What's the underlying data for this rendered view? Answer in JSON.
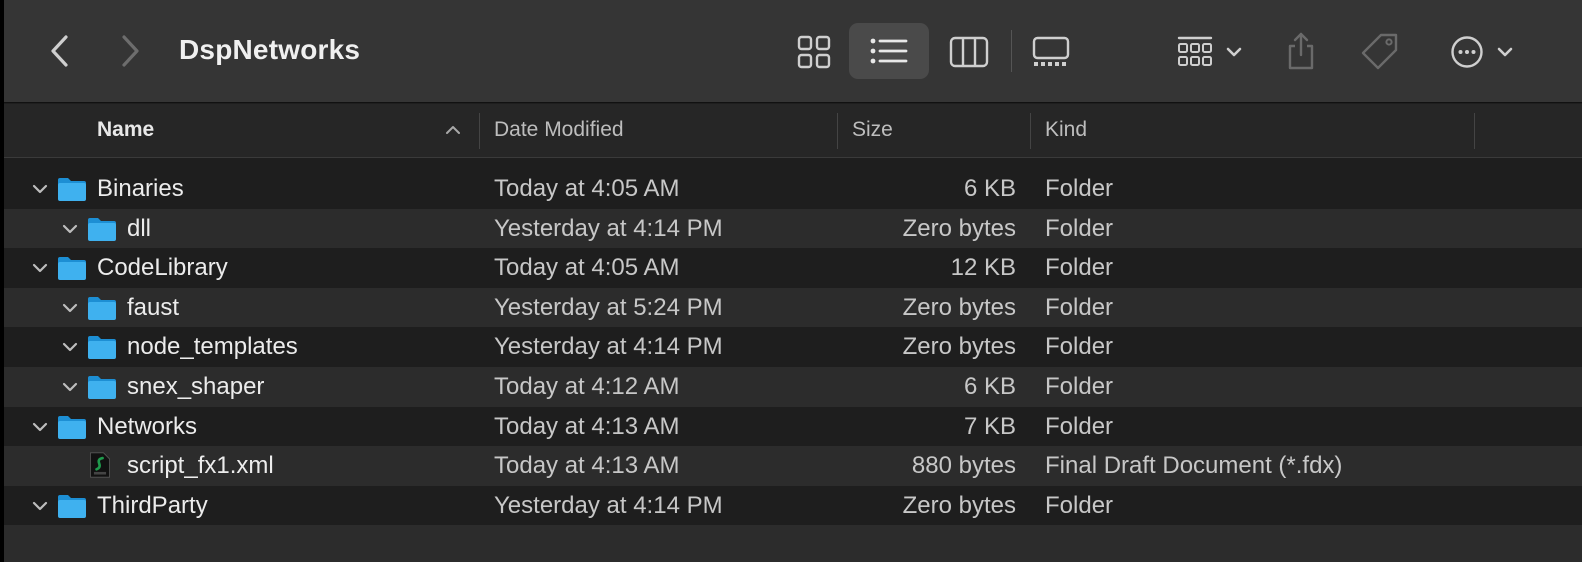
{
  "window": {
    "title": "DspNetworks"
  },
  "toolbar": {
    "back_icon": "chevron-left-icon",
    "forward_icon": "chevron-right-icon",
    "view_icons": "grid-icon",
    "view_list": "list-icon",
    "view_columns": "columns-icon",
    "view_gallery": "gallery-icon",
    "group_icon": "group-icon",
    "share_icon": "share-icon",
    "tag_icon": "tag-icon",
    "more_icon": "ellipsis-circle-icon",
    "active_view": "list"
  },
  "columns": {
    "name": "Name",
    "date": "Date Modified",
    "size": "Size",
    "kind": "Kind",
    "sort": "name-ascending"
  },
  "files": [
    {
      "name": "Binaries",
      "date": "Today at 4:05 AM",
      "size": "6 KB",
      "kind": "Folder",
      "type": "folder",
      "depth": 0,
      "expanded": true
    },
    {
      "name": "dll",
      "date": "Yesterday at 4:14 PM",
      "size": "Zero bytes",
      "kind": "Folder",
      "type": "folder",
      "depth": 1,
      "expanded": true
    },
    {
      "name": "CodeLibrary",
      "date": "Today at 4:05 AM",
      "size": "12 KB",
      "kind": "Folder",
      "type": "folder",
      "depth": 0,
      "expanded": true
    },
    {
      "name": "faust",
      "date": "Yesterday at 5:24 PM",
      "size": "Zero bytes",
      "kind": "Folder",
      "type": "folder",
      "depth": 1,
      "expanded": true
    },
    {
      "name": "node_templates",
      "date": "Yesterday at 4:14 PM",
      "size": "Zero bytes",
      "kind": "Folder",
      "type": "folder",
      "depth": 1,
      "expanded": true
    },
    {
      "name": "snex_shaper",
      "date": "Today at 4:12 AM",
      "size": "6 KB",
      "kind": "Folder",
      "type": "folder",
      "depth": 1,
      "expanded": true
    },
    {
      "name": "Networks",
      "date": "Today at 4:13 AM",
      "size": "7 KB",
      "kind": "Folder",
      "type": "folder",
      "depth": 0,
      "expanded": true
    },
    {
      "name": "script_fx1.xml",
      "date": "Today at 4:13 AM",
      "size": "880 bytes",
      "kind": "Final Draft Document (*.fdx)",
      "type": "document",
      "depth": 1,
      "expanded": false
    },
    {
      "name": "ThirdParty",
      "date": "Yesterday at 4:14 PM",
      "size": "Zero bytes",
      "kind": "Folder",
      "type": "folder",
      "depth": 0,
      "expanded": true
    }
  ],
  "colors": {
    "folder": "#3fb1ef",
    "folder_dark": "#1d8fd4",
    "document": "#1f9a4c"
  }
}
